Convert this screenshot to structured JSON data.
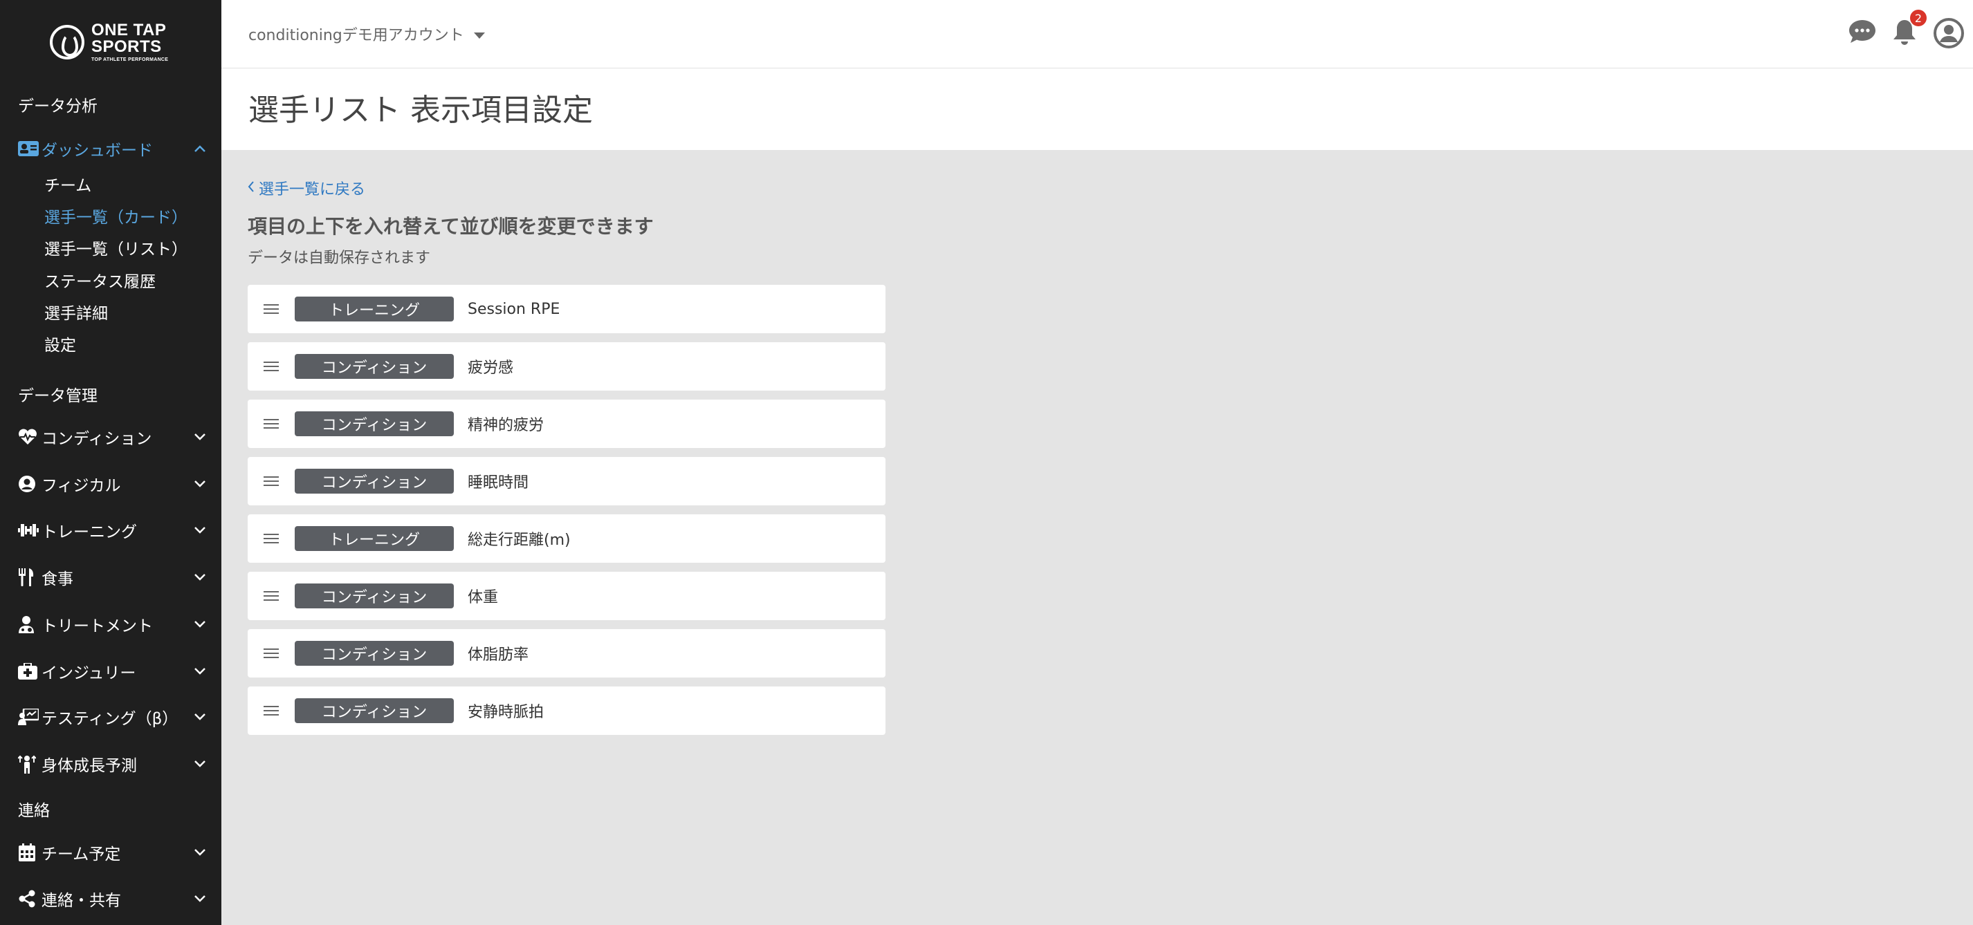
{
  "brand": {
    "line1": "ONE TAP",
    "line2": "SPORTS",
    "tagline": "TOP ATHLETE PERFORMANCE"
  },
  "header": {
    "account_name": "conditioningデモ用アカウント",
    "notification_count": "2",
    "page_title": "選手リスト 表示項目設定"
  },
  "sidebar": {
    "section_analysis": "データ分析",
    "dashboard": "ダッシュボード",
    "dashboard_sub": [
      "チーム",
      "選手一覧（カード）",
      "選手一覧（リスト）",
      "ステータス履歴",
      "選手詳細",
      "設定"
    ],
    "section_data": "データ管理",
    "data_items": [
      "コンディション",
      "フィジカル",
      "トレーニング",
      "食事",
      "トリートメント",
      "インジュリー",
      "テスティング（β）",
      "身体成長予測"
    ],
    "section_contact": "連絡",
    "contact_items": [
      "チーム予定",
      "連絡・共有"
    ]
  },
  "content": {
    "back_link": "選手一覧に戻る",
    "heading": "項目の上下を入れ替えて並び順を変更できます",
    "note": "データは自動保存されます",
    "items": [
      {
        "category": "トレーニング",
        "name": "Session RPE"
      },
      {
        "category": "コンディション",
        "name": "疲労感"
      },
      {
        "category": "コンディション",
        "name": "精神的疲労"
      },
      {
        "category": "コンディション",
        "name": "睡眠時間"
      },
      {
        "category": "トレーニング",
        "name": "総走行距離(m)"
      },
      {
        "category": "コンディション",
        "name": "体重"
      },
      {
        "category": "コンディション",
        "name": "体脂肪率"
      },
      {
        "category": "コンディション",
        "name": "安静時脈拍"
      }
    ]
  },
  "colors": {
    "sidebar_bg": "#1f1f1f",
    "accent": "#5aa7e0",
    "link": "#2f79c2",
    "tag_bg": "#5b5e63",
    "badge": "#d9352a"
  }
}
